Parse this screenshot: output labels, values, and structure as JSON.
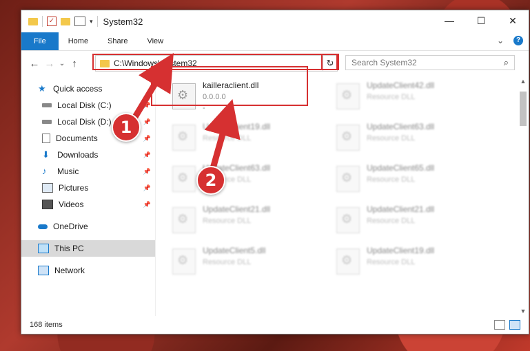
{
  "window": {
    "title": "System32",
    "controls": {
      "minimize": "—",
      "maximize": "☐",
      "close": "✕"
    }
  },
  "ribbon": {
    "tabs": [
      "File",
      "Home",
      "Share",
      "View"
    ],
    "collapse": "⌄",
    "help": "?"
  },
  "address": {
    "path": "C:\\Windows\\System32",
    "refresh": "↻"
  },
  "search": {
    "placeholder": "Search System32"
  },
  "sidebar": {
    "quick_access": "Quick access",
    "items": [
      {
        "label": "Local Disk (C:)",
        "icon": "drive-icon"
      },
      {
        "label": "Local Disk (D:)",
        "icon": "drive-icon"
      },
      {
        "label": "Documents",
        "icon": "documents-icon"
      },
      {
        "label": "Downloads",
        "icon": "downloads-icon"
      },
      {
        "label": "Music",
        "icon": "music-icon"
      },
      {
        "label": "Pictures",
        "icon": "pictures-icon"
      },
      {
        "label": "Videos",
        "icon": "videos-icon"
      }
    ],
    "onedrive": "OneDrive",
    "this_pc": "This PC",
    "network": "Network"
  },
  "files": {
    "highlighted": {
      "name": "kailleraclient.dll",
      "version": "0.0.0.0",
      "desc": "-"
    },
    "left_column": [
      {
        "name": "UpdateClient19.dll",
        "desc": "Resource DLL"
      },
      {
        "name": "UpdateClient63.dll",
        "desc": "Resource DLL"
      },
      {
        "name": "UpdateClient21.dll",
        "desc": "Resource DLL"
      },
      {
        "name": "UpdateClient5.dll",
        "desc": "Resource DLL"
      }
    ],
    "right_column": [
      {
        "name": "UpdateClient42.dll",
        "desc": "Resource DLL"
      },
      {
        "name": "UpdateClient63.dll",
        "desc": "Resource DLL"
      },
      {
        "name": "UpdateClient65.dll",
        "desc": "Resource DLL"
      },
      {
        "name": "UpdateClient21.dll",
        "desc": "Resource DLL"
      },
      {
        "name": "UpdateClient19.dll",
        "desc": "Resource DLL"
      }
    ]
  },
  "status": {
    "count": "168 items"
  },
  "annotations": {
    "step1": "1",
    "step2": "2",
    "color": "#d63031"
  }
}
